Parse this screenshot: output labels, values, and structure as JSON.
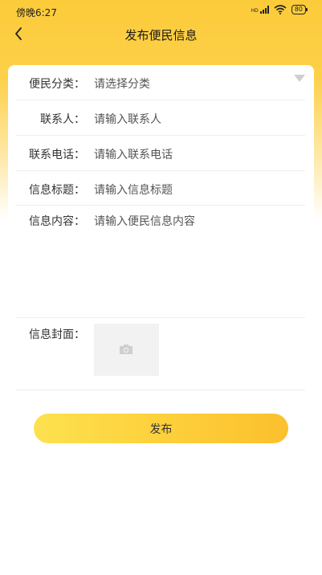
{
  "status_bar": {
    "time": "傍晚6:27",
    "network": "HD",
    "battery": "80"
  },
  "nav": {
    "title": "发布便民信息"
  },
  "form": {
    "category": {
      "label": "便民分类：",
      "placeholder": "请选择分类"
    },
    "contact": {
      "label": "联系人：",
      "placeholder": "请输入联系人"
    },
    "phone": {
      "label": "联系电话：",
      "placeholder": "请输入联系电话"
    },
    "title": {
      "label": "信息标题：",
      "placeholder": "请输入信息标题"
    },
    "content": {
      "label": "信息内容：",
      "placeholder": "请输入便民信息内容"
    },
    "cover": {
      "label": "信息封面："
    }
  },
  "actions": {
    "publish_label": "发布"
  },
  "icons": {
    "back": "chevron-left-icon",
    "dropdown": "triangle-down-icon",
    "upload": "camera-icon"
  },
  "colors": {
    "accent": "#FCCB3A",
    "button_start": "#FDE14F",
    "button_end": "#FBC02D"
  }
}
